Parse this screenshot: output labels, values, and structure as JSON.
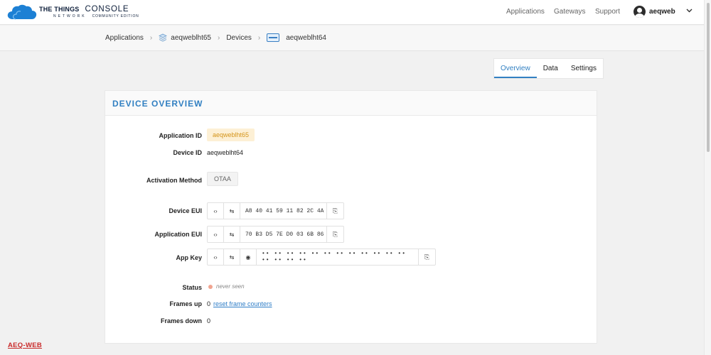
{
  "brand": {
    "line1": "THE THINGS",
    "line2": "CONSOLE",
    "line3": "NETWORK",
    "line4": "COMMUNITY EDITION"
  },
  "nav": {
    "applications": "Applications",
    "gateways": "Gateways",
    "support": "Support"
  },
  "user": {
    "name": "aeqweb"
  },
  "breadcrumb": {
    "applications": "Applications",
    "app": "aeqweblht65",
    "devices": "Devices",
    "device": "aeqweblht64"
  },
  "tabs": [
    "Overview",
    "Data",
    "Settings"
  ],
  "card": {
    "title": "DEVICE OVERVIEW",
    "application_id_label": "Application ID",
    "application_id": "aeqweblht65",
    "device_id_label": "Device ID",
    "device_id": "aeqweblht64",
    "activation_label": "Activation Method",
    "activation": "OTAA",
    "device_eui_label": "Device EUI",
    "device_eui": "A8 40 41 59 11 82 2C 4A",
    "app_eui_label": "Application EUI",
    "app_eui": "70 B3 D5 7E D0 03 6B 86",
    "app_key_label": "App Key",
    "app_key_masked": "•• •• •• •• •• •• •• •• •• •• •• •• •• •• •• ••",
    "status_label": "Status",
    "status": "never seen",
    "frames_up_label": "Frames up",
    "frames_up": "0",
    "reset_link": "reset frame counters",
    "frames_down_label": "Frames down",
    "frames_down": "0"
  },
  "field_buttons": {
    "toggle_format": "‹›",
    "byte_order": "⇆",
    "show": "◉",
    "copy": "⎘"
  },
  "icons": {
    "logo": "cloud-logo-icon",
    "application": "layers-icon",
    "device": "device-icon",
    "chevron": "chevron-down-icon"
  },
  "colors": {
    "accent": "#3280c2",
    "app_chip_bg": "#fdf0d5",
    "app_chip_text": "#d4941a",
    "status_dot": "#f1a490",
    "watermark": "#c92a2a"
  },
  "watermark": "AEQ-WEB"
}
